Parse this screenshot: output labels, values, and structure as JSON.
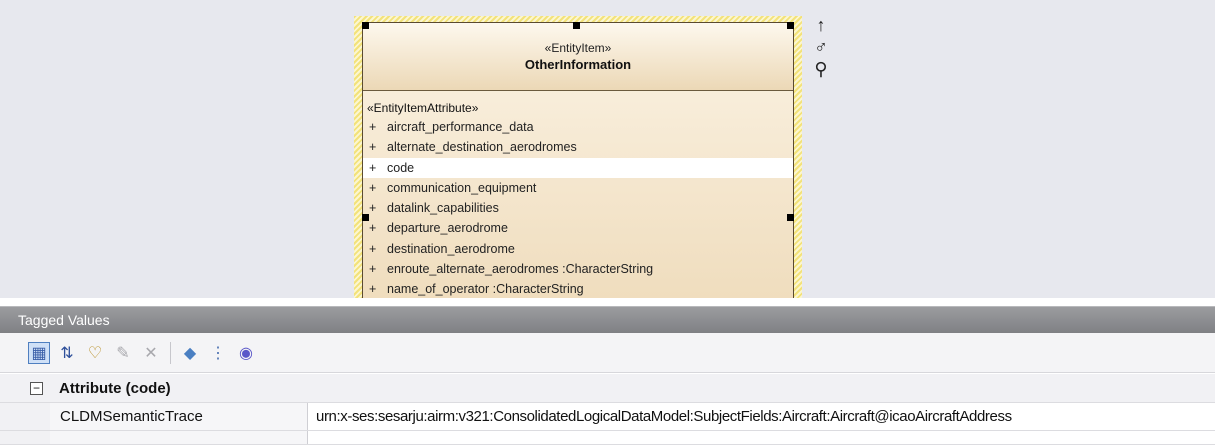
{
  "entity": {
    "stereotype": "«EntityItem»",
    "name": "OtherInformation",
    "attribute_stereotype": "«EntityItemAttribute»",
    "attributes": [
      {
        "vis": "+",
        "text": "aircraft_performance_data"
      },
      {
        "vis": "+",
        "text": "alternate_destination_aerodromes"
      },
      {
        "vis": "+",
        "text": "code"
      },
      {
        "vis": "+",
        "text": "communication_equipment"
      },
      {
        "vis": "+",
        "text": "datalink_capabilities"
      },
      {
        "vis": "+",
        "text": "departure_aerodrome"
      },
      {
        "vis": "+",
        "text": "destination_aerodrome"
      },
      {
        "vis": "+",
        "text": "enroute_alternate_aerodromes   :CharacterString"
      },
      {
        "vis": "+",
        "text": "name_of_operator   :CharacterString"
      }
    ],
    "selected_attribute": "code"
  },
  "side_icons": [
    {
      "name": "arrow-up-icon",
      "glyph": "↑"
    },
    {
      "name": "link-icon",
      "glyph": "♂"
    },
    {
      "name": "magnifier-icon",
      "glyph": "⚲"
    }
  ],
  "tagged_values": {
    "title": "Tagged Values",
    "toolbar": [
      {
        "name": "categorized-view-icon",
        "glyph": "▦",
        "color": "#3b5fa8"
      },
      {
        "name": "sort-az-icon",
        "glyph": "⇅",
        "color": "#2d4f9a"
      },
      {
        "name": "new-tag-icon",
        "glyph": "♡",
        "color": "#b58a1a"
      },
      {
        "name": "edit-notes-icon",
        "glyph": "✎",
        "color": "#a8a8ad"
      },
      {
        "name": "delete-tag-icon",
        "glyph": "✕",
        "color": "#a8a8ad"
      },
      {
        "name": "tag-icon",
        "glyph": "◆",
        "color": "#4a7fc2"
      },
      {
        "name": "filter-icon",
        "glyph": "⋮",
        "color": "#4a6fb0"
      },
      {
        "name": "help-icon",
        "glyph": "◉",
        "color": "#5b58c9"
      }
    ],
    "group": {
      "expander": "−",
      "label": "Attribute (code)"
    },
    "rows": [
      {
        "name": "CLDMSemanticTrace",
        "value": "urn:x-ses:sesarju:airm:v321:ConsolidatedLogicalDataModel:SubjectFields:Aircraft:Aircraft@icaoAircraftAddress"
      }
    ]
  }
}
